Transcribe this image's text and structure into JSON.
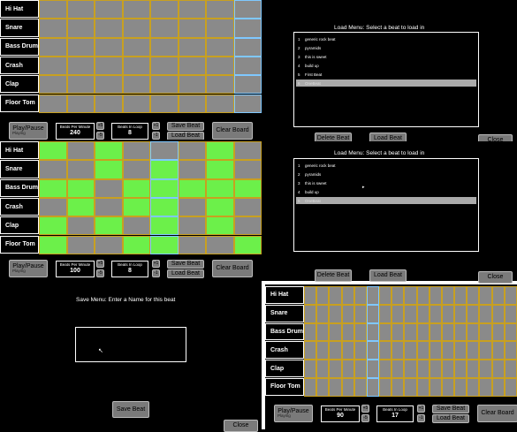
{
  "instruments": [
    "Hi Hat",
    "Snare",
    "Bass Drum",
    "Crash",
    "Clap",
    "Floor Tom"
  ],
  "colors": {
    "cell_off": "#8a8a8a",
    "cell_on": "#6cf04a",
    "cell_border": "#c8a020",
    "playhead": "#7fc8ff"
  },
  "screens": [
    {
      "id": "board-a",
      "play_label": "Play/Pause",
      "play_status": "Playing",
      "bpm_title": "Beats Per Minute",
      "bpm_value": "240",
      "bpm_plus": "+5",
      "bpm_minus": "-5",
      "loop_title": "Beats In Loop",
      "loop_value": "8",
      "loop_plus": "+1",
      "loop_minus": "-1",
      "save_label": "Save Beat",
      "load_label": "Load Beat",
      "clear_label": "Clear Board",
      "playhead": 7,
      "pattern": [
        [
          0,
          0,
          0,
          0,
          0,
          0,
          0,
          0
        ],
        [
          0,
          0,
          0,
          0,
          0,
          0,
          0,
          0
        ],
        [
          0,
          0,
          0,
          0,
          0,
          0,
          0,
          0
        ],
        [
          0,
          0,
          0,
          0,
          0,
          0,
          0,
          0
        ],
        [
          0,
          0,
          0,
          0,
          0,
          0,
          0,
          0
        ],
        [
          0,
          0,
          0,
          0,
          0,
          0,
          0,
          0
        ]
      ]
    },
    {
      "id": "board-b",
      "play_label": "Play/Pause",
      "play_status": "Playing",
      "bpm_title": "Beats Per Minute",
      "bpm_value": "100",
      "bpm_plus": "+5",
      "bpm_minus": "-5",
      "loop_title": "Beats In Loop",
      "loop_value": "8",
      "loop_plus": "+1",
      "loop_minus": "-1",
      "save_label": "Save Beat",
      "load_label": "Load Beat",
      "clear_label": "Clear Board",
      "playhead": 4,
      "pattern": [
        [
          1,
          0,
          1,
          0,
          0,
          0,
          1,
          0
        ],
        [
          0,
          0,
          1,
          0,
          1,
          0,
          1,
          0
        ],
        [
          1,
          1,
          0,
          1,
          1,
          1,
          1,
          1
        ],
        [
          0,
          1,
          0,
          1,
          1,
          0,
          1,
          0
        ],
        [
          1,
          0,
          1,
          0,
          1,
          0,
          1,
          0
        ],
        [
          1,
          0,
          0,
          1,
          1,
          0,
          0,
          1
        ]
      ]
    },
    {
      "id": "board-c",
      "play_label": "Play/Pause",
      "play_status": "Playing",
      "bpm_title": "Beats Per Minute",
      "bpm_value": "90",
      "bpm_plus": "+5",
      "bpm_minus": "-5",
      "loop_title": "Beats In Loop",
      "loop_value": "17",
      "loop_plus": "+1",
      "loop_minus": "-1",
      "save_label": "Save Beat",
      "load_label": "Load Beat",
      "clear_label": "Clear Board",
      "playhead": 5,
      "pattern": [
        [
          0,
          0,
          0,
          0,
          0,
          0,
          0,
          0,
          0,
          0,
          0,
          0,
          0,
          0,
          0,
          0,
          0
        ],
        [
          0,
          0,
          0,
          0,
          0,
          0,
          0,
          0,
          0,
          0,
          0,
          0,
          0,
          0,
          0,
          0,
          0
        ],
        [
          0,
          0,
          0,
          0,
          0,
          0,
          0,
          0,
          0,
          0,
          0,
          0,
          0,
          0,
          0,
          0,
          0
        ],
        [
          0,
          0,
          0,
          0,
          0,
          0,
          0,
          0,
          0,
          0,
          0,
          0,
          0,
          0,
          0,
          0,
          0
        ],
        [
          0,
          0,
          0,
          0,
          0,
          0,
          0,
          0,
          0,
          0,
          0,
          0,
          0,
          0,
          0,
          0,
          0
        ],
        [
          0,
          0,
          0,
          0,
          0,
          0,
          0,
          0,
          0,
          0,
          0,
          0,
          0,
          0,
          0,
          0,
          0
        ]
      ]
    }
  ],
  "load_menus": [
    {
      "title": "Load Menu: Select a beat to load in",
      "items": [
        {
          "num": "1",
          "name": "generic rock beat"
        },
        {
          "num": "2",
          "name": "pyramids"
        },
        {
          "num": "3",
          "name": "this is sweet"
        },
        {
          "num": "4",
          "name": "build up"
        },
        {
          "num": "5",
          "name": "First Beat"
        },
        {
          "num": "6",
          "name": "OneBeat"
        }
      ],
      "selected": 5,
      "delete_label": "Delete Beat",
      "load_label": "Load Beat",
      "close_label": "Close"
    },
    {
      "title": "Load Menu: Select a beat to load in",
      "items": [
        {
          "num": "1",
          "name": "generic rock beat"
        },
        {
          "num": "2",
          "name": "pyramids"
        },
        {
          "num": "3",
          "name": "this is sweet"
        },
        {
          "num": "4",
          "name": "build up"
        },
        {
          "num": "5",
          "name": "OneBeat"
        }
      ],
      "selected": 4,
      "delete_label": "Delete Beat",
      "load_label": "Load Beat",
      "close_label": "Close"
    }
  ],
  "save_menu": {
    "title": "Save Menu: Enter a Name for this beat",
    "name_value": "",
    "save_label": "Save Beat",
    "close_label": "Close"
  }
}
